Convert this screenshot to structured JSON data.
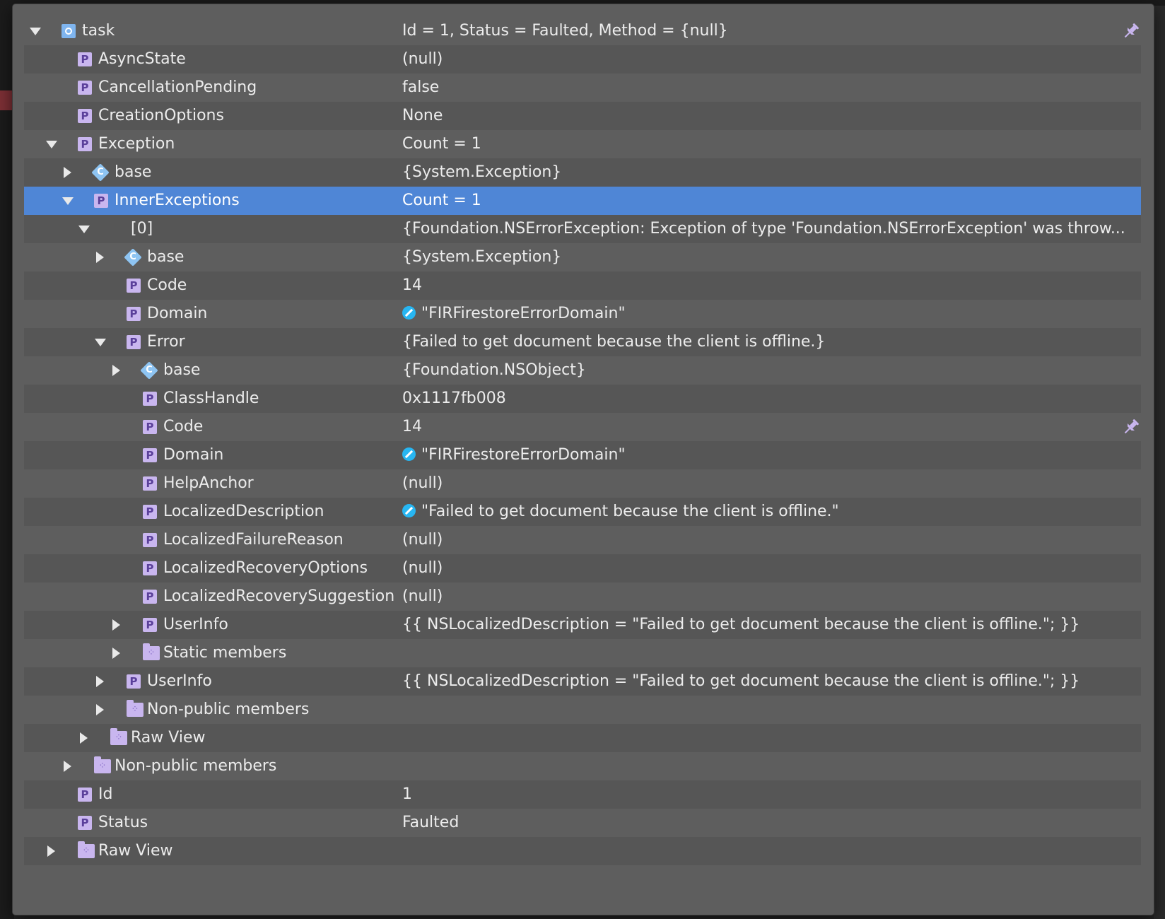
{
  "colors": {
    "popup_bg": "#5e5e5e",
    "row_alt": "#565656",
    "selected": "#4f86d6",
    "property_icon": "#c9b6ef",
    "class_icon": "#8ec4f2",
    "visualizer_icon": "#27b6f2"
  },
  "rows": [
    {
      "name": "task",
      "value": "Id = 1, Status = Faulted, Method = {null}",
      "icon": "object-icon",
      "twisty": "expanded",
      "pin": true
    },
    {
      "name": "AsyncState",
      "value": "(null)",
      "icon": "property-icon"
    },
    {
      "name": "CancellationPending",
      "value": "false",
      "icon": "property-icon"
    },
    {
      "name": "CreationOptions",
      "value": "None",
      "icon": "property-icon"
    },
    {
      "name": "Exception",
      "value": "Count = 1",
      "icon": "property-icon",
      "twisty": "expanded"
    },
    {
      "name": "base",
      "value": "{System.Exception}",
      "icon": "class-icon",
      "twisty": "collapsed"
    },
    {
      "name": "InnerExceptions",
      "value": "Count = 1",
      "icon": "property-icon",
      "twisty": "expanded",
      "selected": true
    },
    {
      "name": "[0]",
      "value": "{Foundation.NSErrorException: Exception of type 'Foundation.NSErrorException' was throw...",
      "twisty": "expanded"
    },
    {
      "name": "base",
      "value": "{System.Exception}",
      "icon": "class-icon",
      "twisty": "collapsed"
    },
    {
      "name": "Code",
      "value": "14",
      "icon": "property-icon"
    },
    {
      "name": "Domain",
      "value": "\"FIRFirestoreErrorDomain\"",
      "icon": "property-icon",
      "visualizer": true
    },
    {
      "name": "Error",
      "value": "{Failed to get document because the client is offline.}",
      "icon": "property-icon",
      "twisty": "expanded"
    },
    {
      "name": "base",
      "value": "{Foundation.NSObject}",
      "icon": "class-icon",
      "twisty": "collapsed"
    },
    {
      "name": "ClassHandle",
      "value": "0x1117fb008",
      "icon": "property-icon"
    },
    {
      "name": "Code",
      "value": "14",
      "icon": "property-icon",
      "pin": true
    },
    {
      "name": "Domain",
      "value": "\"FIRFirestoreErrorDomain\"",
      "icon": "property-icon",
      "visualizer": true
    },
    {
      "name": "HelpAnchor",
      "value": "(null)",
      "icon": "property-icon"
    },
    {
      "name": "LocalizedDescription",
      "value": "\"Failed to get document because the client is offline.\"",
      "icon": "property-icon",
      "visualizer": true
    },
    {
      "name": "LocalizedFailureReason",
      "value": "(null)",
      "icon": "property-icon"
    },
    {
      "name": "LocalizedRecoveryOptions",
      "value": "(null)",
      "icon": "property-icon"
    },
    {
      "name": "LocalizedRecoverySuggestion",
      "value": "(null)",
      "icon": "property-icon"
    },
    {
      "name": "UserInfo",
      "value": "{{     NSLocalizedDescription = \"Failed to get document because the client is offline.\"; }}",
      "icon": "property-icon",
      "twisty": "collapsed"
    },
    {
      "name": "Static members",
      "value": "",
      "icon": "folder-icon",
      "twisty": "collapsed"
    },
    {
      "name": "UserInfo",
      "value": "{{     NSLocalizedDescription = \"Failed to get document because the client is offline.\"; }}",
      "icon": "property-icon",
      "twisty": "collapsed"
    },
    {
      "name": "Non-public members",
      "value": "",
      "icon": "folder-icon",
      "twisty": "collapsed"
    },
    {
      "name": "Raw View",
      "value": "",
      "icon": "folder-icon",
      "twisty": "collapsed"
    },
    {
      "name": "Non-public members",
      "value": "",
      "icon": "folder-icon",
      "twisty": "collapsed"
    },
    {
      "name": "Id",
      "value": "1",
      "icon": "property-icon"
    },
    {
      "name": "Status",
      "value": "Faulted",
      "icon": "property-icon"
    },
    {
      "name": "Raw View",
      "value": "",
      "icon": "folder-icon",
      "twisty": "collapsed"
    }
  ]
}
